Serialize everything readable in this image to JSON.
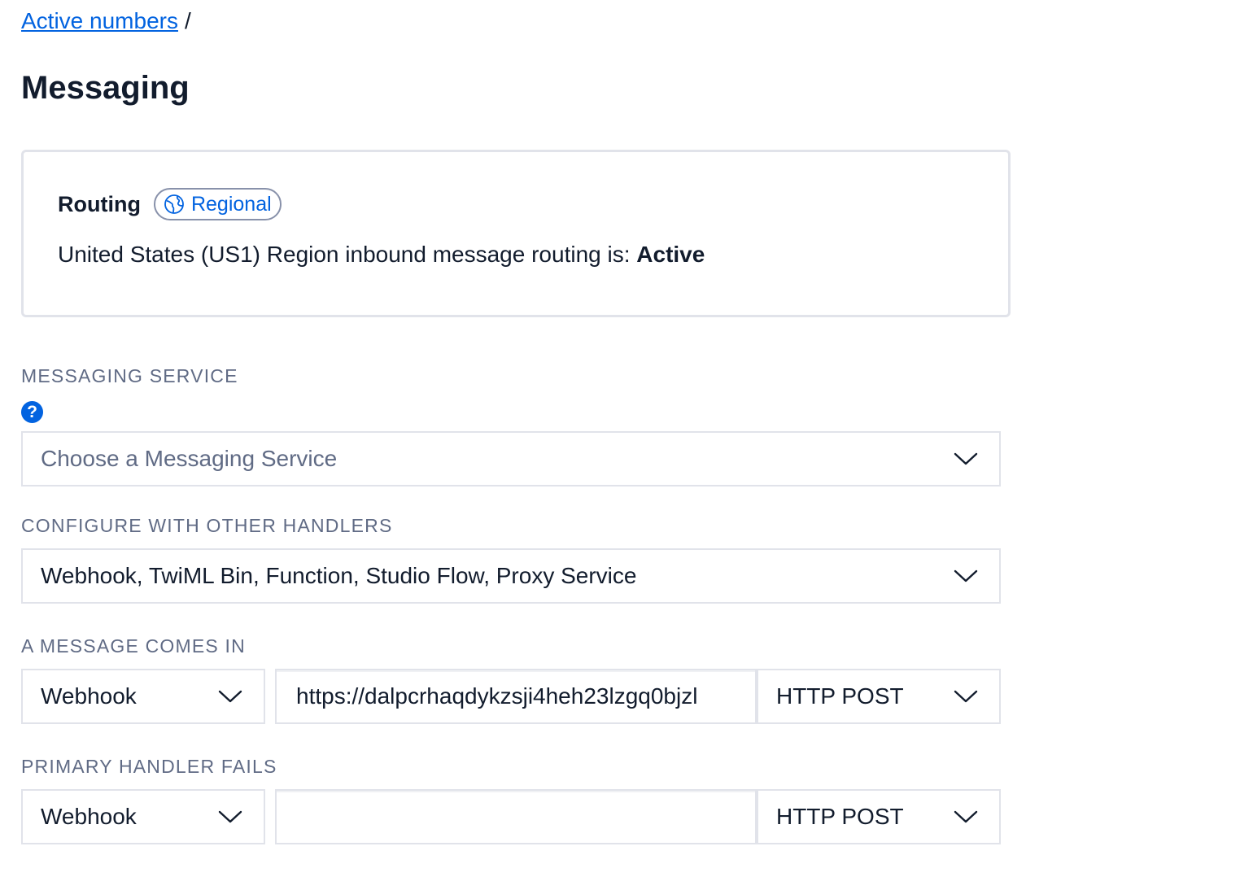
{
  "breadcrumb": {
    "link": "Active numbers",
    "separator": "/"
  },
  "page": {
    "title": "Messaging"
  },
  "routing": {
    "label": "Routing",
    "badge": "Regional",
    "description_prefix": "United States (US1) Region inbound message routing is: ",
    "status": "Active"
  },
  "messaging_service": {
    "label": "MESSAGING SERVICE",
    "placeholder": "Choose a Messaging Service"
  },
  "other_handlers": {
    "label": "CONFIGURE WITH OTHER HANDLERS",
    "value": "Webhook, TwiML Bin, Function, Studio Flow, Proxy Service"
  },
  "message_comes_in": {
    "label": "A MESSAGE COMES IN",
    "handler_type": "Webhook",
    "url": "https://dalpcrhaqdykzsji4heh23lzgq0bjzl",
    "method": "HTTP POST"
  },
  "primary_handler_fails": {
    "label": "PRIMARY HANDLER FAILS",
    "handler_type": "Webhook",
    "url": "",
    "method": "HTTP POST"
  },
  "colors": {
    "link": "#0263e0",
    "text": "#121c2d",
    "label": "#606b85",
    "border": "#e1e3ea"
  }
}
